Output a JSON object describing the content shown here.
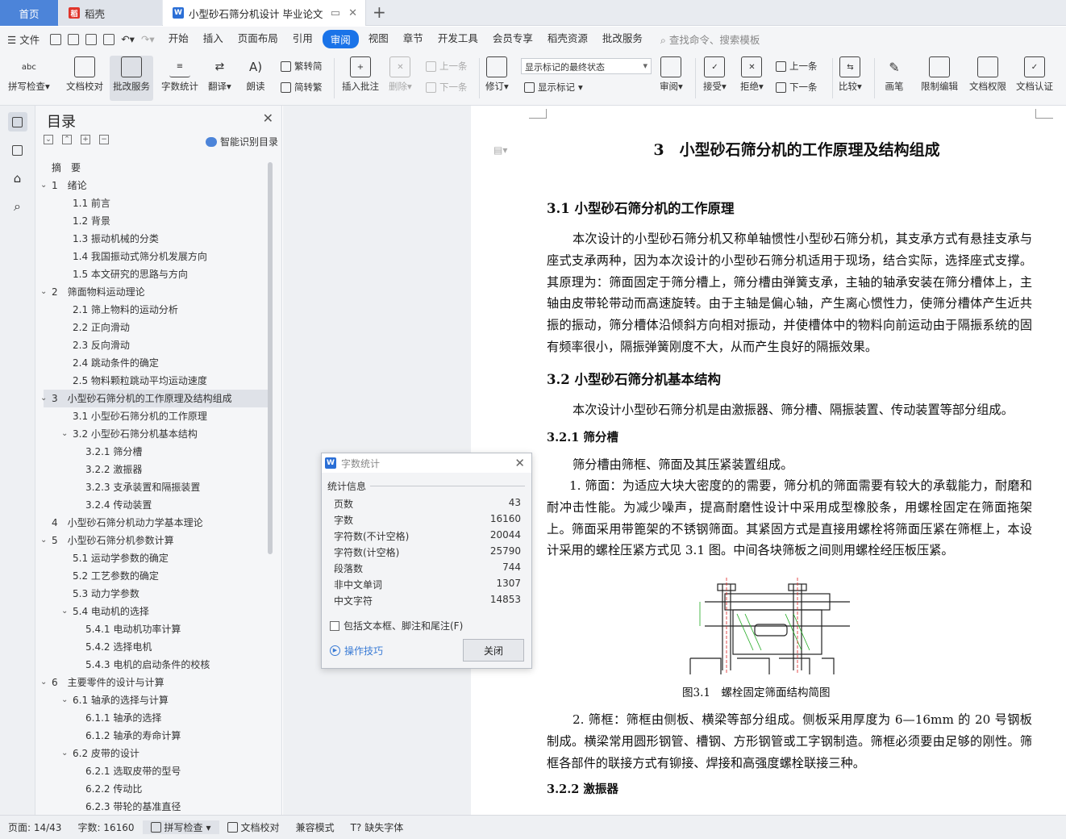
{
  "tabs": {
    "home": "首页",
    "daoke": "稻壳",
    "doc": "小型砂石筛分机设计 毕业论文"
  },
  "menu": {
    "file": "文件",
    "items": [
      "开始",
      "插入",
      "页面布局",
      "引用",
      "审阅",
      "视图",
      "章节",
      "开发工具",
      "会员专享",
      "稻壳资源",
      "批改服务"
    ],
    "active": "审阅",
    "search": "查找命令、搜索模板"
  },
  "ribbon": {
    "spell": "拼写检查",
    "proof": "文档校对",
    "review_service": "批改服务",
    "word_count": "字数统计",
    "translate": "翻译",
    "read_aloud": "朗读",
    "to_trad": "繁转简",
    "to_simp": "简转繁",
    "insert_comment": "插入批注",
    "delete": "删除",
    "prev_comment": "上一条",
    "next_comment": "下一条",
    "revise": "修订",
    "markup_state": "显示标记的最终状态",
    "show_markup": "显示标记",
    "review": "审阅",
    "accept": "接受",
    "reject": "拒绝",
    "prev_change": "上一条",
    "next_change": "下一条",
    "compare": "比较",
    "pen": "画笔",
    "restrict": "限制编辑",
    "permission": "文档权限",
    "certify": "文档认证"
  },
  "nav": {
    "title": "目录",
    "smart": "智能识别目录",
    "toc": [
      {
        "text": "摘　要",
        "level": 0
      },
      {
        "text": "1　绪论",
        "level": 0,
        "arrow": "v"
      },
      {
        "text": "1.1 前言",
        "level": 1
      },
      {
        "text": "1.2 背景",
        "level": 1
      },
      {
        "text": "1.3 振动机械的分类",
        "level": 1
      },
      {
        "text": "1.4 我国振动式筛分机发展方向",
        "level": 1
      },
      {
        "text": "1.5 本文研究的思路与方向",
        "level": 1
      },
      {
        "text": "2　筛面物料运动理论",
        "level": 0,
        "arrow": "v"
      },
      {
        "text": "2.1 筛上物料的运动分析",
        "level": 1
      },
      {
        "text": "2.2 正向滑动",
        "level": 1
      },
      {
        "text": "2.3 反向滑动",
        "level": 1
      },
      {
        "text": "2.4 跳动条件的确定",
        "level": 1
      },
      {
        "text": "2.5 物料颗粒跳动平均运动速度",
        "level": 1
      },
      {
        "text": "3　小型砂石筛分机的工作原理及结构组成",
        "level": 0,
        "arrow": "v",
        "sel": true
      },
      {
        "text": "3.1 小型砂石筛分机的工作原理",
        "level": 1
      },
      {
        "text": "3.2 小型砂石筛分机基本结构",
        "level": 1,
        "arrow": "v"
      },
      {
        "text": "3.2.1 筛分槽",
        "level": 2
      },
      {
        "text": "3.2.2 激振器",
        "level": 2
      },
      {
        "text": "3.2.3 支承装置和隔振装置",
        "level": 2
      },
      {
        "text": "3.2.4 传动装置",
        "level": 2
      },
      {
        "text": "4　小型砂石筛分机动力学基本理论",
        "level": 0
      },
      {
        "text": "5　小型砂石筛分机参数计算",
        "level": 0,
        "arrow": "v"
      },
      {
        "text": "5.1 运动学参数的确定",
        "level": 1
      },
      {
        "text": "5.2 工艺参数的确定",
        "level": 1
      },
      {
        "text": "5.3 动力学参数",
        "level": 1
      },
      {
        "text": "5.4 电动机的选择",
        "level": 1,
        "arrow": "v"
      },
      {
        "text": "5.4.1 电动机功率计算",
        "level": 2
      },
      {
        "text": "5.4.2 选择电机",
        "level": 2
      },
      {
        "text": "5.4.3 电机的启动条件的校核",
        "level": 2
      },
      {
        "text": "6　主要零件的设计与计算",
        "level": 0,
        "arrow": "v"
      },
      {
        "text": "6.1 轴承的选择与计算",
        "level": 1,
        "arrow": "v"
      },
      {
        "text": "6.1.1 轴承的选择",
        "level": 2
      },
      {
        "text": "6.1.2 轴承的寿命计算",
        "level": 2
      },
      {
        "text": "6.2 皮带的设计",
        "level": 1,
        "arrow": "v"
      },
      {
        "text": "6.2.1 选取皮带的型号",
        "level": 2
      },
      {
        "text": "6.2.2 传动比",
        "level": 2
      },
      {
        "text": "6.2.3 带轮的基准直径",
        "level": 2
      }
    ]
  },
  "doc": {
    "h1": "3　小型砂石筛分机的工作原理及结构组成",
    "h2_1": "3.1 小型砂石筛分机的工作原理",
    "p1": "本次设计的小型砂石筛分机又称单轴惯性小型砂石筛分机，其支承方式有悬挂支承与座式支承两种，因为本次设计的小型砂石筛分机适用于现场，结合实际，选择座式支撑。其原理为：筛面固定于筛分槽上，筛分槽由弹簧支承，主轴的轴承安装在筛分槽体上，主轴由皮带轮带动而高速旋转。由于主轴是偏心轴，产生离心惯性力，使筛分槽体产生近共振的振动，筛分槽体沿倾斜方向相对振动，并使槽体中的物料向前运动由于隔振系统的固有频率很小，隔振弹簧刚度不大，从而产生良好的隔振效果。",
    "h2_2": "3.2 小型砂石筛分机基本结构",
    "p2": "本次设计小型砂石筛分机是由激振器、筛分槽、隔振装置、传动装置等部分组成。",
    "h3_1": "3.2.1 筛分槽",
    "p3": "筛分槽由筛框、筛面及其压紧装置组成。",
    "p4": "1. 筛面：为适应大块大密度的的需要，筛分机的筛面需要有较大的承载能力，耐磨和耐冲击性能。为减少噪声，提高耐磨性设计中采用成型橡胶条，用螺栓固定在筛面拖架上。筛面采用带篦架的不锈钢筛面。其紧固方式是直接用螺栓将筛面压紧在筛框上，本设计采用的螺栓压紧方式见 3.1 图。中间各块筛板之间则用螺栓经压板压紧。",
    "fig_caption": "图3.1　螺栓固定筛面结构简图",
    "p5": "2. 筛框：筛框由侧板、横梁等部分组成。侧板采用厚度为 6—16mm 的 20 号钢板制成。横梁常用圆形钢管、槽钢、方形钢管或工字钢制造。筛框必须要由足够的刚性。筛框各部件的联接方式有铆接、焊接和高强度螺栓联接三种。",
    "h3_2": "3.2.2 激振器"
  },
  "dialog": {
    "title": "字数统计",
    "section": "统计信息",
    "stats": [
      {
        "label": "页数",
        "value": "43"
      },
      {
        "label": "字数",
        "value": "16160"
      },
      {
        "label": "字符数(不计空格)",
        "value": "20044"
      },
      {
        "label": "字符数(计空格)",
        "value": "25790"
      },
      {
        "label": "段落数",
        "value": "744"
      },
      {
        "label": "非中文单词",
        "value": "1307"
      },
      {
        "label": "中文字符",
        "value": "14853"
      }
    ],
    "include": "包括文本框、脚注和尾注(F)",
    "tips": "操作技巧",
    "close": "关闭"
  },
  "status": {
    "page": "页面: 14/43",
    "words": "字数: 16160",
    "spell": "拼写检查",
    "proof": "文档校对",
    "compat": "兼容模式",
    "missing_font": "缺失字体"
  },
  "colors": {
    "accent": "#1a73e8",
    "home_tab": "#4c84d9"
  }
}
